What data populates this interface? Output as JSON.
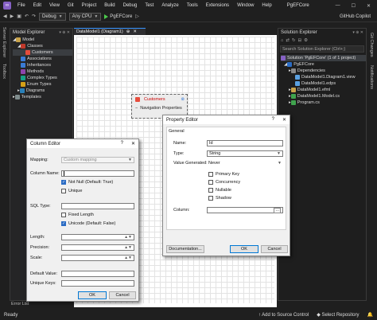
{
  "menubar": {
    "logo": "∞",
    "items": [
      "File",
      "Edit",
      "View",
      "Git",
      "Project",
      "Build",
      "Debug",
      "Test",
      "Analyze",
      "Tools",
      "Extensions",
      "Window",
      "Help"
    ],
    "project_title": "PgEFCore",
    "min": "—",
    "max": "☐",
    "close": "✕"
  },
  "toolbar": {
    "config": "Debug",
    "platform": "Any CPU",
    "run_target": "PgEFCore",
    "copilot": "GitHub Copilot"
  },
  "left_strip": {
    "server_explorer": "Server Explorer",
    "toolbox": "Toolbox"
  },
  "model_explorer": {
    "title": "Model Explorer",
    "tree": [
      "Model",
      "Classes",
      "Customers",
      "Associations",
      "Inheritances",
      "Methods",
      "Complex Types",
      "Enum Types",
      "Diagrams",
      "Templates"
    ]
  },
  "document": {
    "tab_label": "DataModel1 (Diagram1)",
    "pin": "⊕",
    "close": "✕"
  },
  "entity": {
    "name": "Customers",
    "prop": "Navigation Properties"
  },
  "column_editor": {
    "title": "Column Editor",
    "help": "?",
    "close": "✕",
    "mapping_label": "Mapping:",
    "mapping_value": "Custom mapping",
    "column_name_label": "Column Name:",
    "column_name_value": "",
    "not_null": "Not Null (Default: True)",
    "unique": "Unique",
    "sql_type_label": "SQL Type:",
    "fixed_length": "Fixed Length",
    "unicode": "Unicode (Default: False)",
    "length_label": "Length:",
    "precision_label": "Precision:",
    "scale_label": "Scale:",
    "default_value_label": "Default Value:",
    "unique_keys_label": "Unique Keys:",
    "ok": "OK",
    "cancel": "Cancel"
  },
  "property_editor": {
    "title": "Property Editor",
    "help": "?",
    "close": "✕",
    "section": "General",
    "name_label": "Name:",
    "name_value": "Id",
    "type_label": "Type:",
    "type_value": "String",
    "generated_label": "Value Generated:",
    "generated_value": "Never",
    "primary_key": "Primary Key",
    "concurrency": "Concurrency",
    "nullable": "Nullable",
    "shadow": "Shadow",
    "column_label": "Column:",
    "column_btn": "...",
    "documentation": "Documentation...",
    "ok": "OK",
    "cancel": "Cancel"
  },
  "solution_explorer": {
    "title": "Solution Explorer",
    "search_placeholder": "Search Solution Explorer (Ctrl+;)",
    "tree": [
      "Solution 'PgEFCore' (1 of 1 project)",
      "PgEFCore",
      "Dependencies",
      "DataModel1.Diagram1.view",
      "DataModel1.edps",
      "DataModel1.efml",
      "DataModel1.Model.cs",
      "Program.cs"
    ]
  },
  "right_strip": {
    "git_changes": "Git Changes",
    "notifications": "Notifications"
  },
  "error_list": "Error List",
  "statusbar": {
    "ready": "Ready",
    "source_control": "Add to Source Control",
    "repo": "Select Repository"
  },
  "colors": {
    "accent": "#3794ff",
    "entity_name": "#cc0000",
    "checked": "#2b6cc4"
  }
}
